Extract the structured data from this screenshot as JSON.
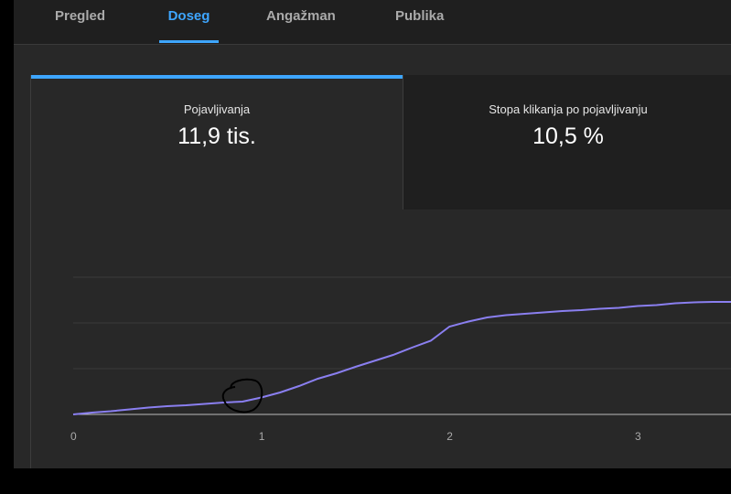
{
  "tabs": [
    {
      "label": "Pregled",
      "active": false
    },
    {
      "label": "Doseg",
      "active": true
    },
    {
      "label": "Angažman",
      "active": false
    },
    {
      "label": "Publika",
      "active": false
    }
  ],
  "metrics": [
    {
      "label": "Pojavljivanja",
      "value": "11,9 tis.",
      "selected": true
    },
    {
      "label": "Stopa klikanja po pojavljivanju",
      "value": "10,5 %",
      "selected": false
    }
  ],
  "colors": {
    "accent": "#3ea6ff",
    "series": "#8a7ff0"
  },
  "chart_data": {
    "type": "line",
    "x_ticks": [
      "0",
      "1",
      "2",
      "3"
    ],
    "xlim": [
      0,
      3.5
    ],
    "grid": true,
    "series": [
      {
        "x": [
          0,
          0.1,
          0.2,
          0.3,
          0.4,
          0.5,
          0.6,
          0.7,
          0.8,
          0.9,
          1.0,
          1.1,
          1.2,
          1.3,
          1.4,
          1.5,
          1.6,
          1.7,
          1.8,
          1.9,
          2.0,
          2.1,
          2.2,
          2.3,
          2.4,
          2.5,
          2.6,
          2.7,
          2.8,
          2.9,
          3.0,
          3.1,
          3.2,
          3.3,
          3.4,
          3.5
        ],
        "values": [
          0,
          0.2,
          0.35,
          0.55,
          0.75,
          0.9,
          1.0,
          1.15,
          1.3,
          1.4,
          1.85,
          2.4,
          3.1,
          3.9,
          4.5,
          5.2,
          5.85,
          6.5,
          7.3,
          8.05,
          9.6,
          10.15,
          10.6,
          10.85,
          11.0,
          11.15,
          11.3,
          11.4,
          11.55,
          11.65,
          11.85,
          11.95,
          12.15,
          12.25,
          12.3,
          12.3
        ],
        "ylim": [
          0,
          15
        ]
      }
    ]
  }
}
